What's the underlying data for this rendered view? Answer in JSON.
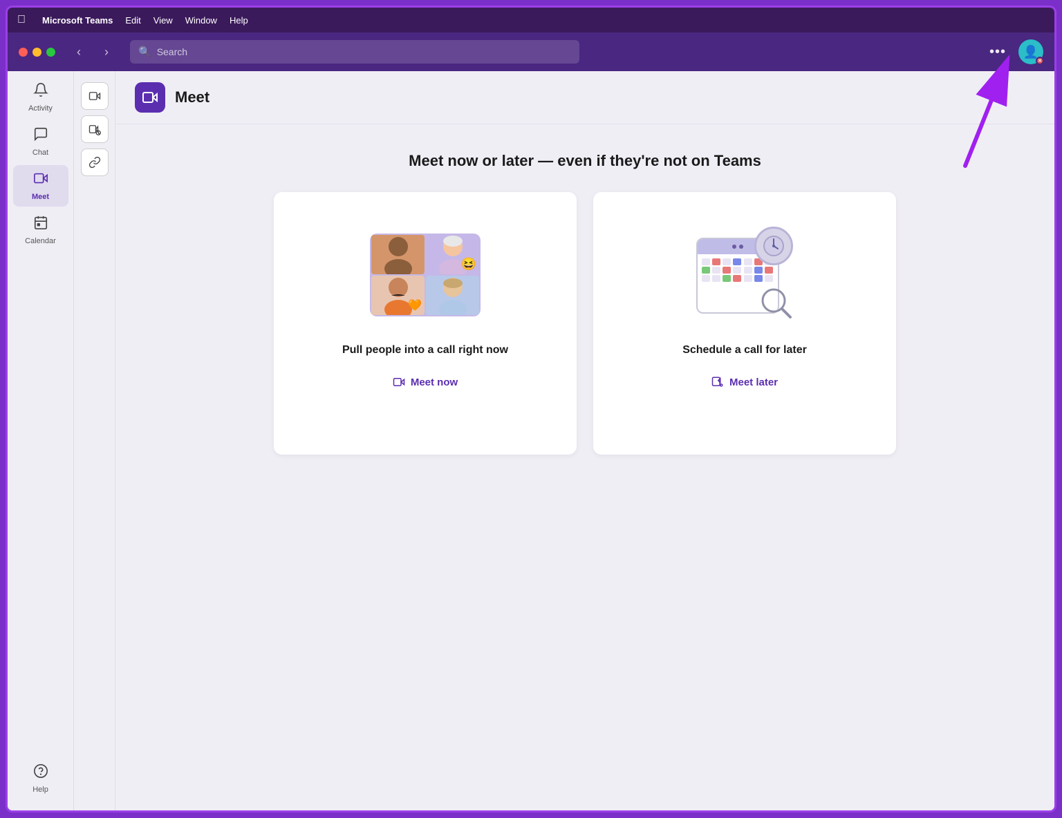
{
  "menubar": {
    "app_name": "Microsoft Teams",
    "menu_items": [
      "Edit",
      "View",
      "Window",
      "Help"
    ]
  },
  "toolbar": {
    "search_placeholder": "Search",
    "more_label": "•••"
  },
  "sidebar": {
    "items": [
      {
        "id": "activity",
        "label": "Activity",
        "icon": "🔔"
      },
      {
        "id": "chat",
        "label": "Chat",
        "icon": "💬"
      },
      {
        "id": "meet",
        "label": "Meet",
        "icon": "📹",
        "active": true
      },
      {
        "id": "calendar",
        "label": "Calendar",
        "icon": "📅"
      }
    ],
    "bottom_items": [
      {
        "id": "help",
        "label": "Help",
        "icon": "❓"
      }
    ]
  },
  "action_bar": {
    "buttons": [
      {
        "id": "meet-now-action",
        "icon": "📹"
      },
      {
        "id": "meet-later-action",
        "icon": "📅"
      },
      {
        "id": "copy-link-action",
        "icon": "🔗"
      }
    ]
  },
  "page": {
    "title": "Meet",
    "headline": "Meet now or later — even if they're not on Teams",
    "cards": [
      {
        "id": "meet-now",
        "subtitle": "Pull people into a call right now",
        "action_label": "Meet now",
        "action_icon": "📹"
      },
      {
        "id": "meet-later",
        "subtitle": "Schedule a call for later",
        "action_label": "Meet later",
        "action_icon": "📅"
      }
    ]
  }
}
